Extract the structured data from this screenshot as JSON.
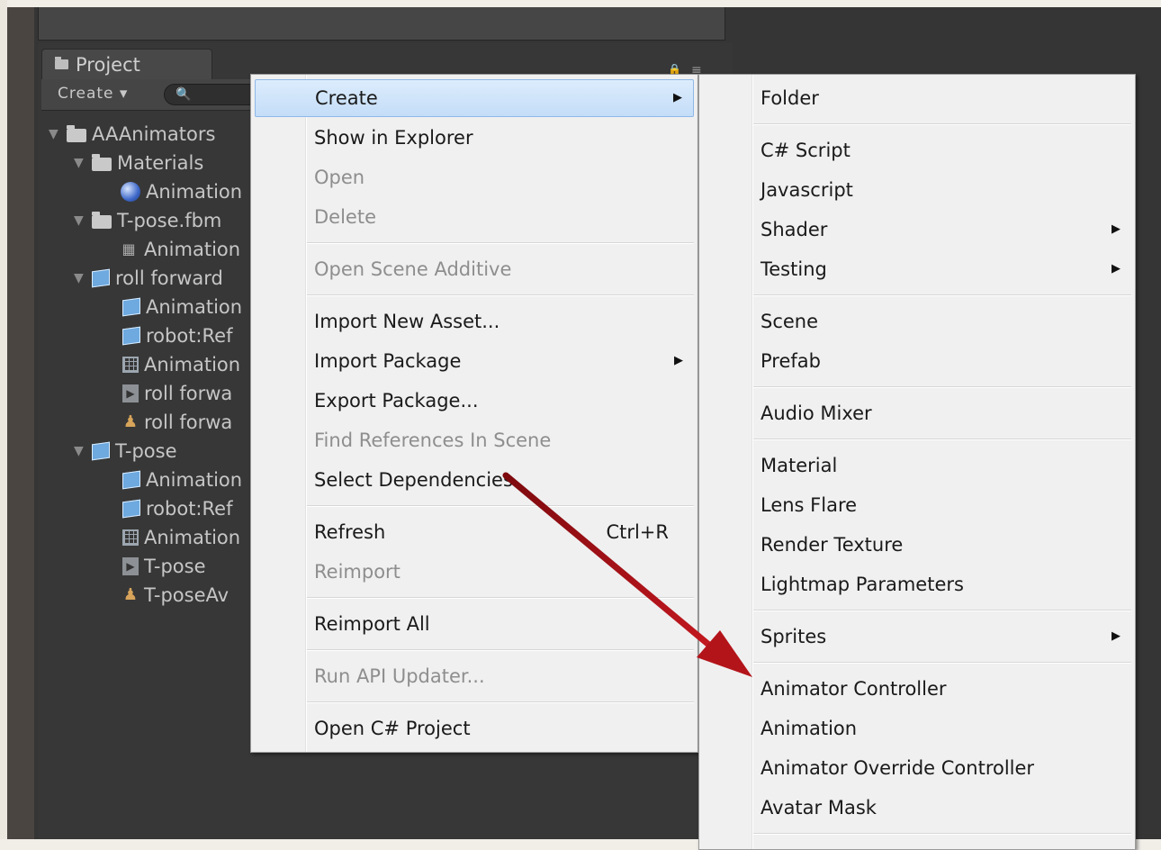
{
  "project_panel": {
    "tab_label": "Project",
    "create_label": "Create ▾",
    "search_placeholder": "🔍",
    "tree": [
      {
        "label": "AAAnimators",
        "icon": "folder-icon"
      },
      {
        "label": "Materials",
        "icon": "folder-icon"
      },
      {
        "label": "Animation",
        "icon": "material-sphere-icon"
      },
      {
        "label": "T-pose.fbm",
        "icon": "folder-icon"
      },
      {
        "label": "Animation",
        "icon": "texture-icon"
      },
      {
        "label": "roll forward",
        "icon": "model-prefab-icon"
      },
      {
        "label": "Animation",
        "icon": "model-prefab-icon"
      },
      {
        "label": "robot:Ref",
        "icon": "model-prefab-icon"
      },
      {
        "label": "Animation",
        "icon": "mesh-grid-icon"
      },
      {
        "label": "roll forwa",
        "icon": "animation-clip-icon"
      },
      {
        "label": "roll forwa",
        "icon": "avatar-icon"
      },
      {
        "label": "T-pose",
        "icon": "model-prefab-icon"
      },
      {
        "label": "Animation",
        "icon": "model-prefab-icon"
      },
      {
        "label": "robot:Ref",
        "icon": "model-prefab-icon"
      },
      {
        "label": "Animation",
        "icon": "mesh-grid-icon"
      },
      {
        "label": "T-pose",
        "icon": "animation-clip-icon"
      },
      {
        "label": "T-poseAv",
        "icon": "avatar-icon"
      }
    ]
  },
  "context_menu": {
    "items": [
      {
        "label": "Create",
        "submenu": true,
        "highlighted": true
      },
      {
        "label": "Show in Explorer"
      },
      {
        "label": "Open",
        "disabled": true
      },
      {
        "label": "Delete",
        "disabled": true
      },
      {
        "label": "Open Scene Additive",
        "disabled": true
      },
      {
        "label": "Import New Asset..."
      },
      {
        "label": "Import Package",
        "submenu": true
      },
      {
        "label": "Export Package..."
      },
      {
        "label": "Find References In Scene",
        "disabled": true
      },
      {
        "label": "Select Dependencies"
      },
      {
        "label": "Refresh",
        "shortcut": "Ctrl+R"
      },
      {
        "label": "Reimport",
        "disabled": true
      },
      {
        "label": "Reimport All"
      },
      {
        "label": "Run API Updater...",
        "disabled": true
      },
      {
        "label": "Open C# Project"
      }
    ]
  },
  "create_submenu": {
    "items": [
      {
        "label": "Folder"
      },
      {
        "label": "C# Script"
      },
      {
        "label": "Javascript"
      },
      {
        "label": "Shader",
        "submenu": true
      },
      {
        "label": "Testing",
        "submenu": true
      },
      {
        "label": "Scene"
      },
      {
        "label": "Prefab"
      },
      {
        "label": "Audio Mixer"
      },
      {
        "label": "Material"
      },
      {
        "label": "Lens Flare"
      },
      {
        "label": "Render Texture"
      },
      {
        "label": "Lightmap Parameters"
      },
      {
        "label": "Sprites",
        "submenu": true
      },
      {
        "label": "Animator Controller"
      },
      {
        "label": "Animation"
      },
      {
        "label": "Animator Override Controller"
      },
      {
        "label": "Avatar Mask"
      }
    ]
  },
  "colors": {
    "annotation_arrow": "#b3141a",
    "menu_highlight": "#c4ddf8"
  }
}
